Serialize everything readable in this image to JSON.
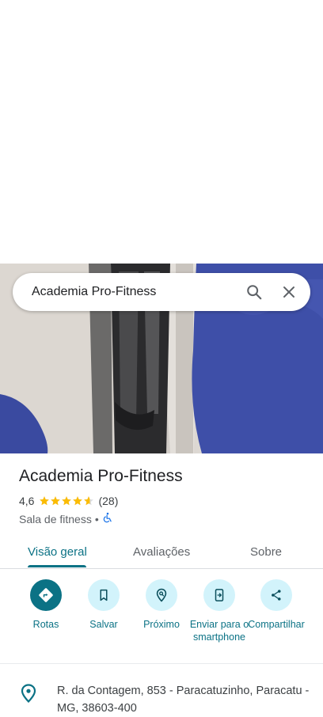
{
  "search": {
    "query": "Academia Pro-Fitness"
  },
  "place": {
    "name": "Academia Pro-Fitness",
    "rating": "4,6",
    "rating_value": 4.6,
    "review_count": "(28)",
    "category": "Sala de fitness",
    "separator": "•"
  },
  "tabs": [
    {
      "label": "Visão geral",
      "active": true
    },
    {
      "label": "Avaliações",
      "active": false
    },
    {
      "label": "Sobre",
      "active": false
    }
  ],
  "actions": [
    {
      "label": "Rotas",
      "icon": "directions-icon"
    },
    {
      "label": "Salvar",
      "icon": "bookmark-icon"
    },
    {
      "label": "Próximo",
      "icon": "nearby-icon"
    },
    {
      "label": "Enviar para o smartphone",
      "icon": "send-to-phone-icon"
    },
    {
      "label": "Compartilhar",
      "icon": "share-icon"
    }
  ],
  "address": {
    "text": "R. da Contagem, 853 - Paracatuzinho, Paracatu - MG, 38603-400"
  },
  "colors": {
    "accent": "#0b7285",
    "action_bg": "#d2f3fb",
    "star": "#fbbc04"
  }
}
